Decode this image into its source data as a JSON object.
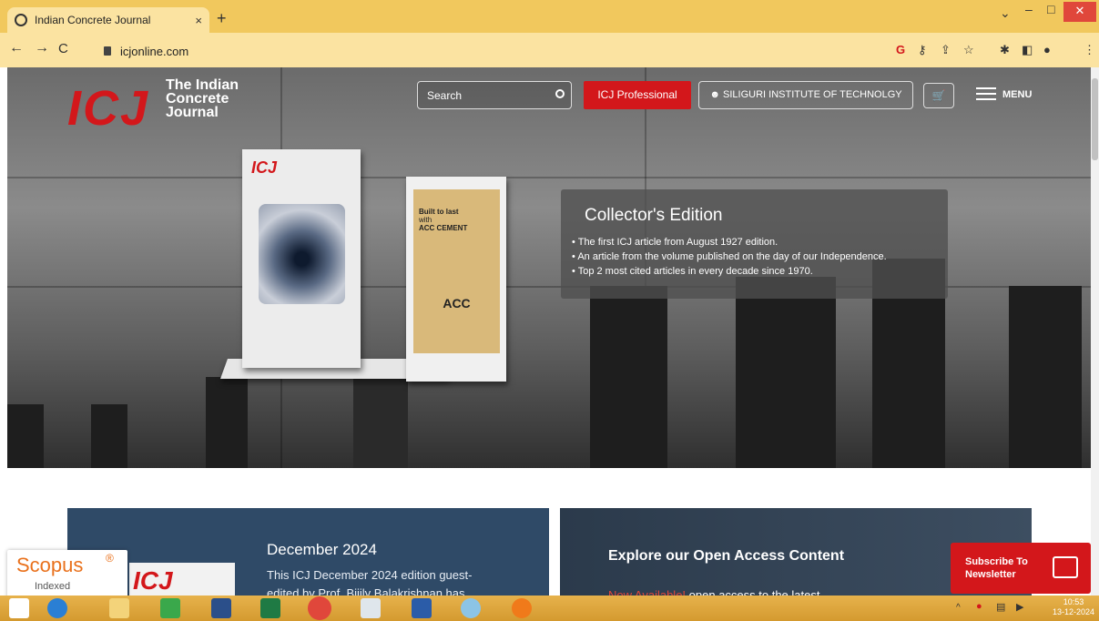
{
  "browser": {
    "tab_title": "Indian Concrete Journal",
    "tab_close": "×",
    "new_tab": "+",
    "url": "icjonline.com",
    "win_min": "–",
    "win_max": "□",
    "win_close": "✕",
    "back": "←",
    "forward": "→",
    "reload": "C",
    "toolbar_icons": [
      "google-icon",
      "key-icon",
      "share-icon",
      "star-icon",
      "extensions-icon",
      "sidepanel-icon",
      "profile-icon",
      "kebab-menu-icon"
    ]
  },
  "header": {
    "logo": "ICJ",
    "logo_line1": "The Indian",
    "logo_line2": "Concrete",
    "logo_line3": "Journal",
    "search_placeholder": "Search",
    "pro_button": "ICJ Professional",
    "institution_button": "SILIGURI INSTITUTE OF TECHNOLGY",
    "menu_label": "MENU"
  },
  "hero": {
    "book1_logo": "ICJ",
    "book2_line1": "Built to last",
    "book2_line2": "with",
    "book2_line3": "ACC CEMENT",
    "book2_brand": "ACC",
    "title": "Collector's Edition",
    "bullets": [
      "The first ICJ article from August 1927 edition.",
      "An article from the volume published on the day of our Independence.",
      "Top 2 most cited articles in every decade since 1970."
    ]
  },
  "cards": {
    "left_title": "December 2024",
    "left_text": "This ICJ December 2024 edition guest-",
    "left_text2": "edited by Prof. Bijily Balakrishnan has",
    "left_logo": "ICJ",
    "right_title": "Explore our Open Access Content",
    "right_highlight": "Now Available!",
    "right_text": " open access to the latest"
  },
  "scopus": {
    "name": "Scopus",
    "reg": "®",
    "sub": "Indexed"
  },
  "subscribe": {
    "line1": "Subscribe To",
    "line2": "Newsletter"
  },
  "taskbar": {
    "time": "10:53",
    "date": "13-12-2024"
  }
}
